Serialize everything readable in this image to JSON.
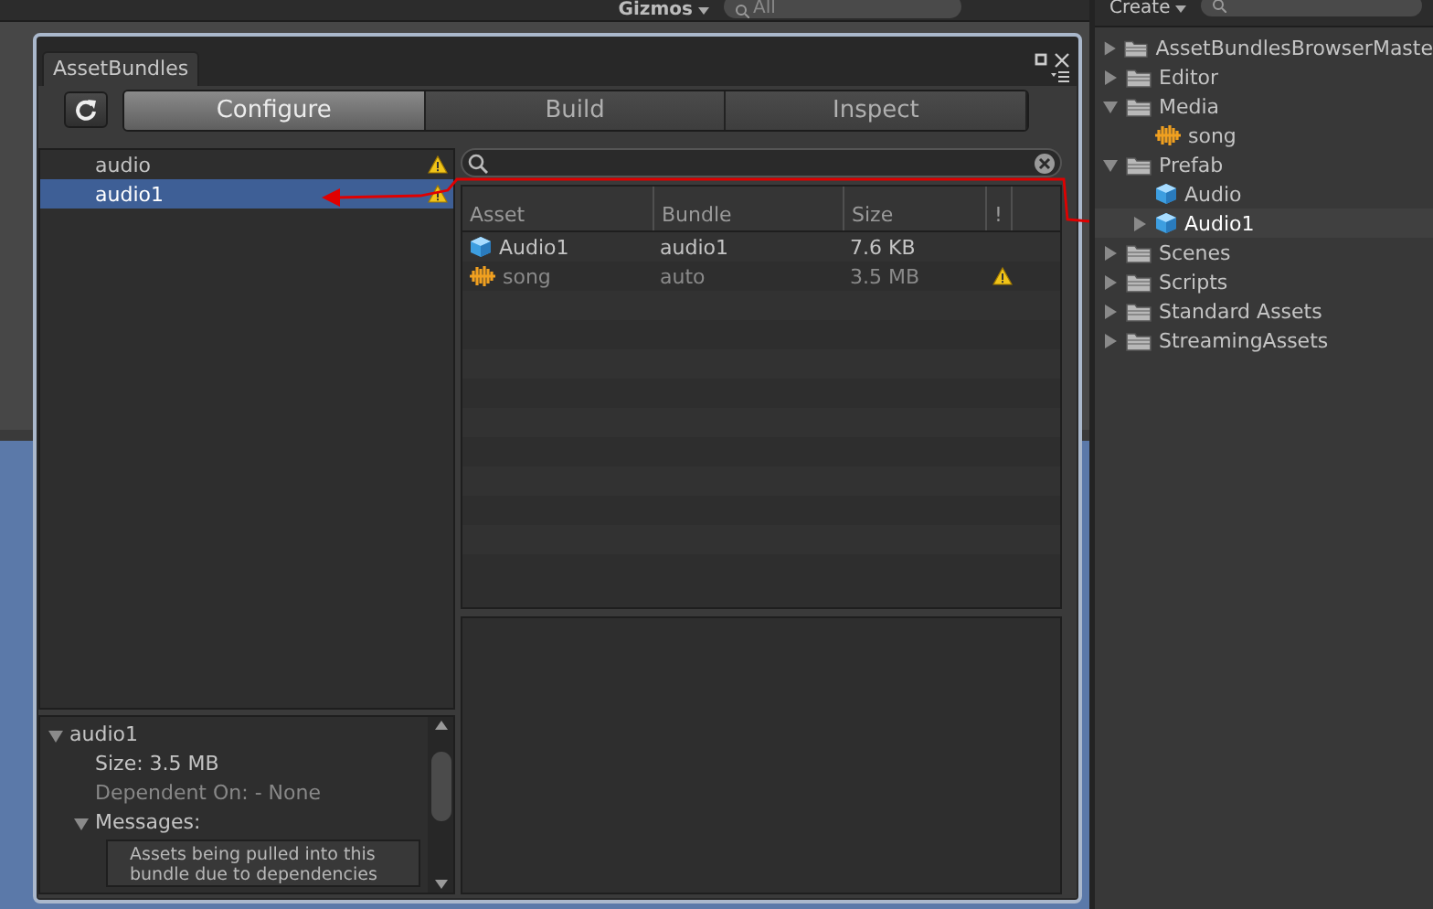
{
  "scene_toolbar": {
    "gizmos": "Gizmos",
    "search_placeholder": "All"
  },
  "window": {
    "tab": "AssetBundles",
    "modes": [
      {
        "label": "Configure",
        "selected": true
      },
      {
        "label": "Build",
        "selected": false
      },
      {
        "label": "Inspect",
        "selected": false
      }
    ]
  },
  "bundles": [
    {
      "name": "audio",
      "selected": false,
      "warning": true
    },
    {
      "name": "audio1",
      "selected": true,
      "warning": true
    }
  ],
  "asset_table": {
    "columns": [
      "Asset",
      "Bundle",
      "Size",
      "!"
    ],
    "rows": [
      {
        "kind": "prefab",
        "asset": "Audio1",
        "bundle": "audio1",
        "size": "7.6 KB",
        "dimmed": false,
        "warning": false
      },
      {
        "kind": "audio",
        "asset": "song",
        "bundle": "auto",
        "size": "3.5 MB",
        "dimmed": true,
        "warning": true
      }
    ]
  },
  "details": {
    "title": "audio1",
    "expanded": true,
    "size": "Size: 3.5 MB",
    "dependent_on": "Dependent On: - None",
    "messages_label": "Messages:",
    "messages_expanded": true,
    "message": "Assets being pulled into this bundle due to dependencies"
  },
  "project": {
    "create": "Create",
    "tree": [
      {
        "kind": "folder",
        "name": "AssetBundlesBrowserMaste",
        "expanded": false,
        "selected": false
      },
      {
        "kind": "folder",
        "name": "Editor",
        "expanded": false,
        "selected": false
      },
      {
        "kind": "folder",
        "name": "Media",
        "expanded": true,
        "selected": false,
        "children": [
          {
            "kind": "audio",
            "name": "song",
            "selected": false
          }
        ]
      },
      {
        "kind": "folder",
        "name": "Prefab",
        "expanded": true,
        "selected": false,
        "children": [
          {
            "kind": "prefab",
            "name": "Audio",
            "selected": false
          },
          {
            "kind": "prefab",
            "name": "Audio1",
            "selected": true,
            "expanded": false
          }
        ]
      },
      {
        "kind": "folder",
        "name": "Scenes",
        "expanded": false,
        "selected": false
      },
      {
        "kind": "folder",
        "name": "Scripts",
        "expanded": false,
        "selected": false
      },
      {
        "kind": "folder",
        "name": "Standard Assets",
        "expanded": false,
        "selected": false
      },
      {
        "kind": "folder",
        "name": "StreamingAssets",
        "expanded": false,
        "selected": false
      }
    ]
  }
}
